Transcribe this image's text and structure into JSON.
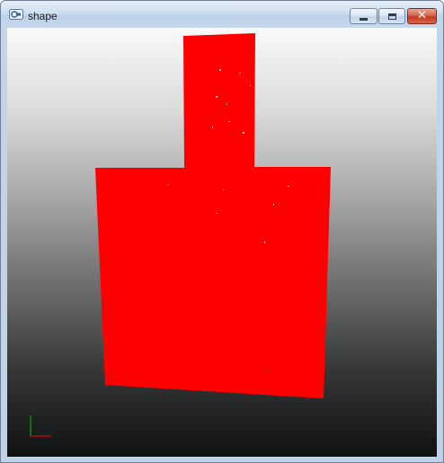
{
  "window": {
    "title": "shape",
    "icon": "app-icon",
    "controls": {
      "minimize": "minimize-icon",
      "maximize": "maximize-icon",
      "close": "close-icon"
    }
  },
  "viewport": {
    "shape_color": "#ff0000",
    "axis_colors": {
      "x": "#ff0000",
      "y": "#00c000"
    }
  }
}
